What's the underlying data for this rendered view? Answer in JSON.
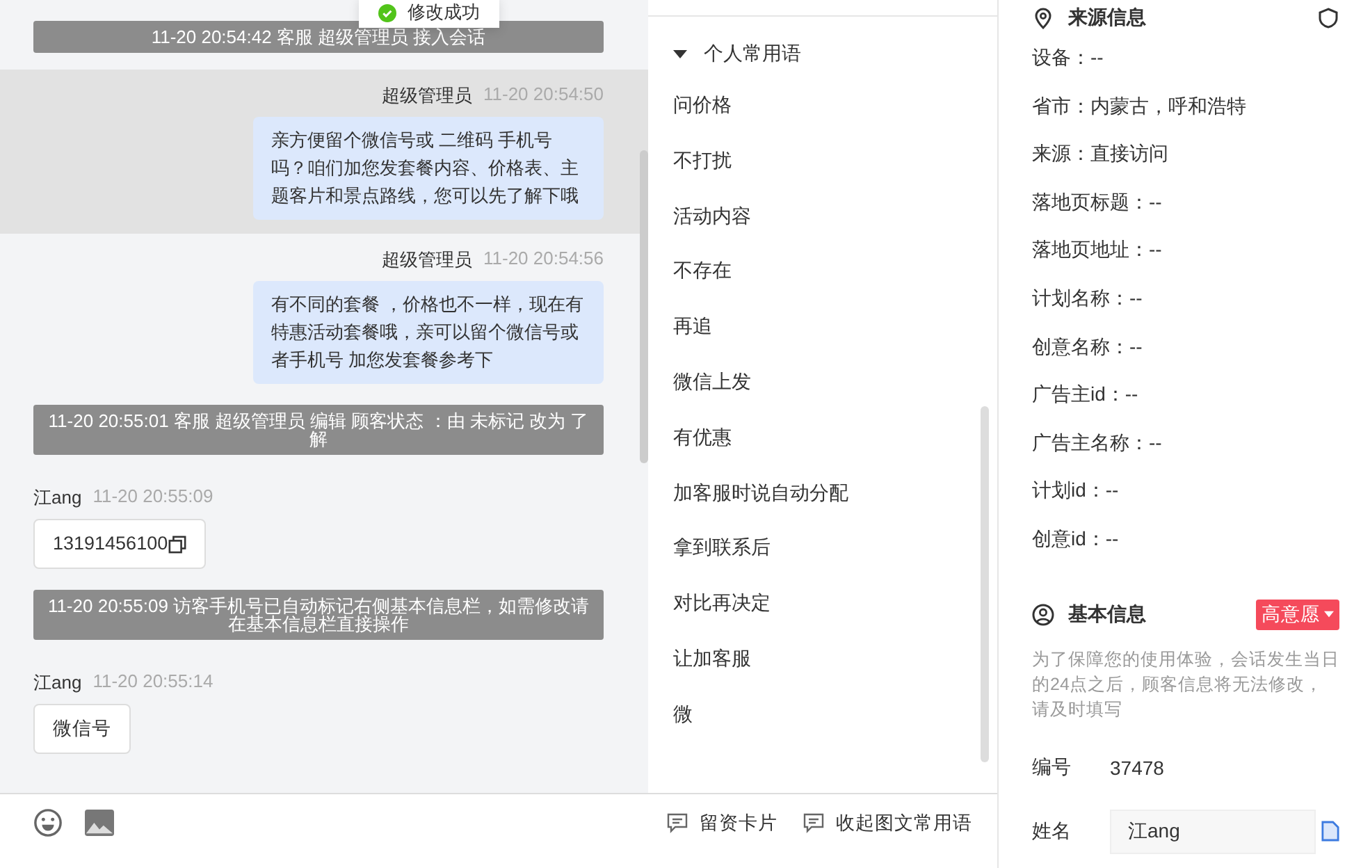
{
  "toast": {
    "text": "修改成功"
  },
  "messages": [
    {
      "kind": "system",
      "text": "11-20 20:54:42 客服 超级管理员 接入会话",
      "highlighted": false
    },
    {
      "kind": "agent",
      "sender": "超级管理员",
      "time": "11-20 20:54:50",
      "text": "亲方便留个微信号或 二维码 手机号吗？咱们加您发套餐内容、价格表、主题客片和景点路线，您可以先了解下哦",
      "highlighted": true
    },
    {
      "kind": "agent",
      "sender": "超级管理员",
      "time": "11-20 20:54:56",
      "text": "有不同的套餐 ，价格也不一样，现在有特惠活动套餐哦，亲可以留个微信号或者手机号 加您发套餐参考下",
      "highlighted": false
    },
    {
      "kind": "system",
      "text": "11-20 20:55:01 客服 超级管理员 编辑 顾客状态 ：由 未标记 改为 了解",
      "highlighted": false
    },
    {
      "kind": "visitor",
      "sender": "江ang",
      "time": "11-20 20:55:09",
      "text": "13191456100",
      "copyable": true,
      "highlighted": false
    },
    {
      "kind": "system",
      "text": "11-20 20:55:09 访客手机号已自动标记右侧基本信息栏，如需修改请在基本信息栏直接操作",
      "highlighted": false
    },
    {
      "kind": "visitor",
      "sender": "江ang",
      "time": "11-20 20:55:14",
      "text": "微信号",
      "copyable": false,
      "highlighted": false
    }
  ],
  "composer": {
    "tools": [
      {
        "kind": "emoji"
      },
      {
        "kind": "image"
      }
    ],
    "buttons": [
      {
        "label": "留资卡片"
      },
      {
        "label": "收起图文常用语"
      }
    ]
  },
  "phrases": {
    "group": {
      "label": "个人常用语",
      "expanded": true
    },
    "items": [
      "问价格",
      "不打扰",
      "活动内容",
      "不存在",
      "再追",
      "微信上发",
      "有优惠",
      "加客服时说自动分配",
      "拿到联系后",
      "对比再决定",
      "让加客服",
      "微"
    ]
  },
  "source_info": {
    "title": "来源信息",
    "fields": [
      "设备：--",
      "省市：内蒙古，呼和浩特",
      "来源：直接访问",
      "落地页标题：--",
      "落地页地址：--",
      "计划名称：--",
      "创意名称：--",
      "广告主id：--",
      "广告主名称：--",
      "计划id：--",
      "创意id：--"
    ]
  },
  "basic_info": {
    "title": "基本信息",
    "tag": "高意愿",
    "note": "为了保障您的使用体验，会话发生当日的24点之后，顾客信息将无法修改，请及时填写",
    "fields": [
      {
        "kind": "text",
        "label": "编号",
        "value": "37478"
      },
      {
        "kind": "input",
        "label": "姓名",
        "value": "江ang"
      }
    ]
  }
}
